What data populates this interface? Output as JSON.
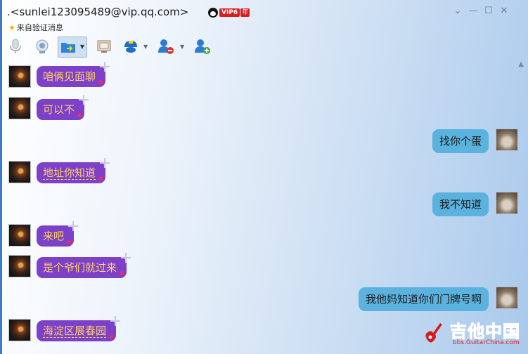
{
  "header": {
    "contact": ".<sunlei123095489@vip.qq.com>",
    "vip_label": "VIP6",
    "vip_year": "年",
    "status": "来自验证消息"
  },
  "toolbar": {
    "icons": [
      "microphone-icon",
      "video-icon",
      "file-transfer-icon",
      "screen-share-icon",
      "remote-assist-icon",
      "remove-contact-icon",
      "add-contact-icon"
    ]
  },
  "messages": [
    {
      "side": "left",
      "text": "咱俩见面聊"
    },
    {
      "side": "left",
      "text": "可以不"
    },
    {
      "side": "right",
      "text": "找你个蛋"
    },
    {
      "side": "left",
      "text": "地址你知道"
    },
    {
      "side": "right",
      "text": "我不知道"
    },
    {
      "side": "left",
      "text": "来吧"
    },
    {
      "side": "left",
      "text": "是个爷们就过来"
    },
    {
      "side": "right",
      "text": "我他妈知道你们门牌号啊"
    },
    {
      "side": "left",
      "text": "海淀区展春园"
    }
  ],
  "watermark": {
    "title": "吉他中国",
    "url": "bbs.GuitarChina.com"
  },
  "colors": {
    "left_bubble": "#7c40c9",
    "left_text": "#ffd067",
    "right_bubble": "#5bb2df",
    "watermark": "#d21d1d"
  }
}
